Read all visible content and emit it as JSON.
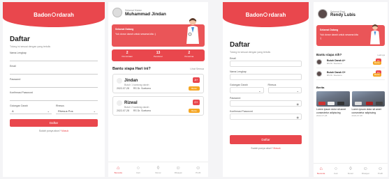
{
  "brand": {
    "name_pre": "Badon",
    "name_post": "rdarah",
    "color": "#e9474d"
  },
  "register": {
    "title": "Daftar",
    "subtitle": "Tolong isi sesuai dengan yang tertulis",
    "fields": [
      {
        "label": "Nama Lengkap",
        "value": ""
      },
      {
        "label": "Email",
        "value": ""
      },
      {
        "label": "Password",
        "value": ""
      },
      {
        "label": "Konfirmasi Password",
        "value": ""
      }
    ],
    "blood_label": "Golongan Darah",
    "blood_value": "A",
    "rhesus_label": "Rhesus",
    "rhesus_value": "Rhesus Pos",
    "button": "Daftar",
    "footer_text": "Sudah punya akun?",
    "footer_link": "Masuk"
  },
  "register2": {
    "title": "Daftar",
    "subtitle": "Tolong isi sesuai dengan yang tertulis",
    "fields": [
      "Email",
      "Nama Lengkap",
      "Golongan Darah",
      "Rhesus",
      "Password",
      "Konfirmasi Password"
    ],
    "button": "Daftar",
    "footer_text": "Sudah punya akun?",
    "footer_link": "Masuk"
  },
  "home": {
    "greeting": "Selamat Malam",
    "name": "Muhammad Jindan",
    "banner_title": "Selamat Datang",
    "banner_text": "Yuk donor darah untuk sesama kita :)",
    "stats": [
      {
        "n": "2",
        "l": "Permintaan"
      },
      {
        "n": "13",
        "l": "Pendonor"
      },
      {
        "n": "2",
        "l": "Penerima"
      }
    ],
    "section_title": "Bantu siapa Hari ini?",
    "section_more": "Lihat Semua",
    "cards": [
      {
        "name": "Jindan",
        "desc": "Butuh 1 kantong darah",
        "date": "2022-07-28",
        "loc": "RS Dr. Soetomo",
        "blood": "A+",
        "button": "Bantu"
      },
      {
        "name": "Rizwal",
        "desc": "Butuh 2 kantong darah",
        "date": "2022-07-28",
        "loc": "RS Dr. Soetomo",
        "blood": "O+",
        "button": "Bantu"
      }
    ],
    "nav": [
      "Beranda",
      "Cari",
      "Donor",
      "Riwayat",
      "Profil"
    ]
  },
  "home2": {
    "greeting": "Selamat Pagi",
    "name": "Rendy Lubis",
    "banner_title": "Selamat Datang",
    "banner_text": "Yuk donor darah untuk sesama kita :)",
    "section_title": "Bantu siapa nih?",
    "section_more": "Lainnya",
    "items": [
      {
        "name": "Butuh Darah A+",
        "desc": "RS Dr. Soetomo",
        "blood": "A+",
        "button": "Bantu"
      },
      {
        "name": "Butuh Darah O+",
        "desc": "RS Dr. Soetomo",
        "blood": "O+",
        "button": "Bantu"
      }
    ],
    "news_title": "Berita",
    "news": [
      {
        "title": "Lorem ipsum dolor sit amet consectetur adipiscing",
        "date": "2022-07-28"
      },
      {
        "title": "Lorem ipsum dolor sit amet consectetur adipiscing",
        "date": "2022-07-28"
      }
    ],
    "nav": [
      "Beranda",
      "Cari",
      "Donor",
      "Riwayat",
      "Profil"
    ]
  }
}
